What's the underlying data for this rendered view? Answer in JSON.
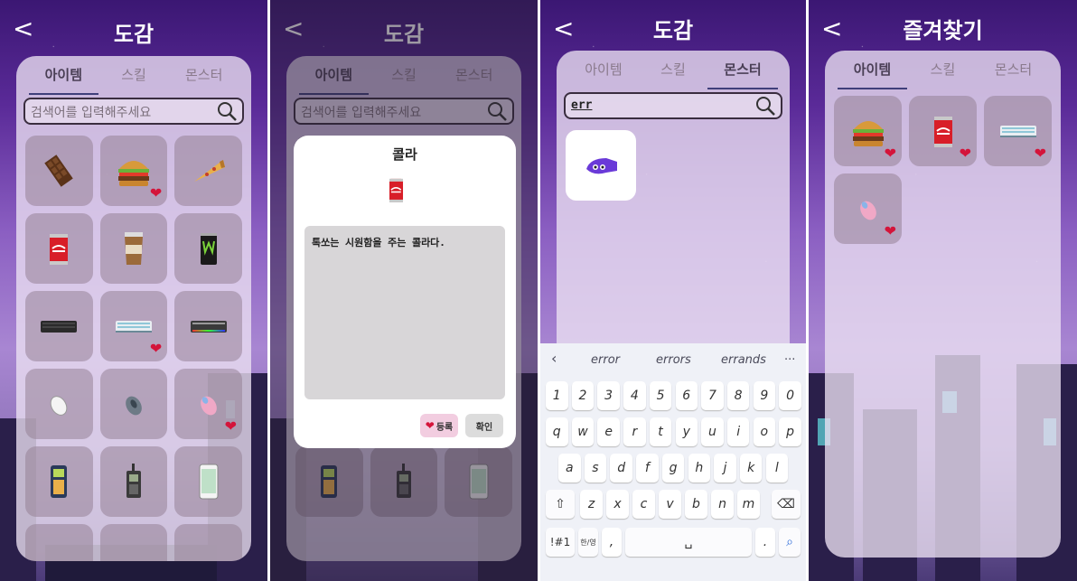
{
  "screen1": {
    "title": "도감",
    "back": "<",
    "tabs": [
      "아이템",
      "스킬",
      "몬스터"
    ],
    "search_placeholder": "검색어를 입력해주세요",
    "items": [
      {
        "icon": "chocolate-icon",
        "favorite": false
      },
      {
        "icon": "burger-icon",
        "favorite": true
      },
      {
        "icon": "pizza-icon",
        "favorite": false
      },
      {
        "icon": "cola-icon",
        "favorite": false
      },
      {
        "icon": "coffee-icon",
        "favorite": false
      },
      {
        "icon": "energy-drink-icon",
        "favorite": false
      },
      {
        "icon": "keyboard-black-icon",
        "favorite": false
      },
      {
        "icon": "keyboard-white-icon",
        "favorite": true
      },
      {
        "icon": "keyboard-rgb-icon",
        "favorite": false
      },
      {
        "icon": "mouse-white-icon",
        "favorite": false
      },
      {
        "icon": "mouse-grey-icon",
        "favorite": false
      },
      {
        "icon": "mouse-pink-icon",
        "favorite": true
      },
      {
        "icon": "old-phone-icon",
        "favorite": false
      },
      {
        "icon": "walkie-phone-icon",
        "favorite": false
      },
      {
        "icon": "smartphone-icon",
        "favorite": false
      }
    ]
  },
  "screen2": {
    "title": "도감",
    "back": "<",
    "tabs": [
      "아이템",
      "스킬",
      "몬스터"
    ],
    "search_placeholder": "검색어를 입력해주세요",
    "dialog": {
      "title": "콜라",
      "description": "톡쏘는 시원함을 주는 콜라다.",
      "register_label": "등록",
      "confirm_label": "확인"
    }
  },
  "screen3": {
    "title": "도감",
    "back": "<",
    "tabs": [
      "아이템",
      "스킬",
      "몬스터"
    ],
    "search_value": "err",
    "result_icon": "monster-blob-icon",
    "keyboard": {
      "suggestions": [
        "error",
        "errors",
        "errands"
      ],
      "more": "···",
      "row1": [
        "1",
        "2",
        "3",
        "4",
        "5",
        "6",
        "7",
        "8",
        "9",
        "0"
      ],
      "row2": [
        "q",
        "w",
        "e",
        "r",
        "t",
        "y",
        "u",
        "i",
        "o",
        "p"
      ],
      "row3": [
        "a",
        "s",
        "d",
        "f",
        "g",
        "h",
        "j",
        "k",
        "l"
      ],
      "row4": [
        "z",
        "x",
        "c",
        "v",
        "b",
        "n",
        "m"
      ],
      "sym_label": "!#1",
      "lang_label": "한/영",
      "comma": ",",
      "period": "."
    }
  },
  "screen4": {
    "title": "즐겨찾기",
    "back": "<",
    "tabs": [
      "아이템",
      "스킬",
      "몬스터"
    ],
    "items": [
      {
        "icon": "burger-icon",
        "favorite": true
      },
      {
        "icon": "cola-icon",
        "favorite": true
      },
      {
        "icon": "keyboard-white-icon",
        "favorite": true
      },
      {
        "icon": "mouse-pink-icon",
        "favorite": true
      }
    ]
  },
  "colors": {
    "heart": "#d4143a",
    "panel": "#ece2f2",
    "tab_underline": "#3f3f7a",
    "sky_top": "#3b1773"
  }
}
